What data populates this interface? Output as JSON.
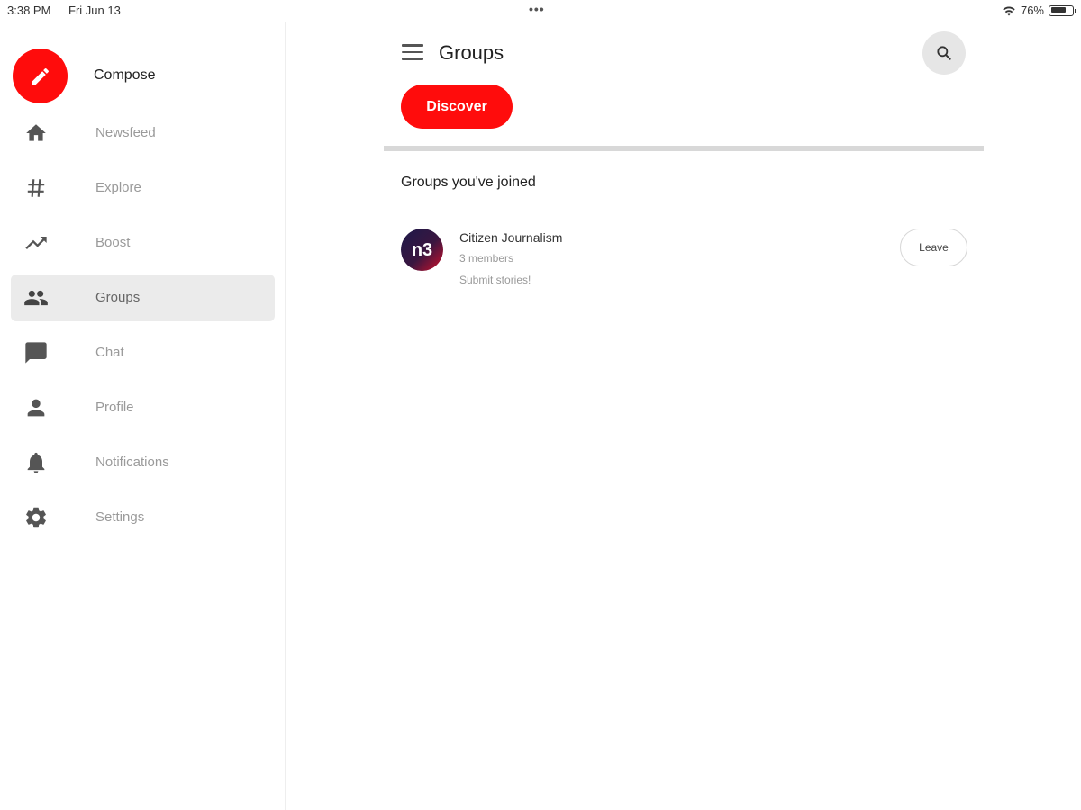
{
  "status_bar": {
    "time": "3:38 PM",
    "date": "Fri Jun 13",
    "battery": "76%",
    "battery_level": 0.76,
    "dots": "•••"
  },
  "sidebar": {
    "compose_label": "Compose",
    "items": [
      {
        "label": "Newsfeed",
        "icon": "home-icon"
      },
      {
        "label": "Explore",
        "icon": "hashtag-icon"
      },
      {
        "label": "Boost",
        "icon": "trending-icon"
      },
      {
        "label": "Groups",
        "icon": "groups-icon",
        "active": true
      },
      {
        "label": "Chat",
        "icon": "chat-icon"
      },
      {
        "label": "Profile",
        "icon": "person-icon"
      },
      {
        "label": "Notifications",
        "icon": "bell-icon"
      },
      {
        "label": "Settings",
        "icon": "gear-icon"
      }
    ]
  },
  "header": {
    "title": "Groups"
  },
  "discover_label": "Discover",
  "section_title": "Groups you've joined",
  "groups": [
    {
      "name": "Citizen Journalism",
      "members": "3 members",
      "description": "Submit stories!",
      "avatar_text": "n3",
      "leave_label": "Leave"
    }
  ],
  "colors": {
    "accent": "#ff0c0c",
    "active_bg": "#ebebeb",
    "icon": "#555555",
    "muted_text": "#9a9a9a"
  }
}
